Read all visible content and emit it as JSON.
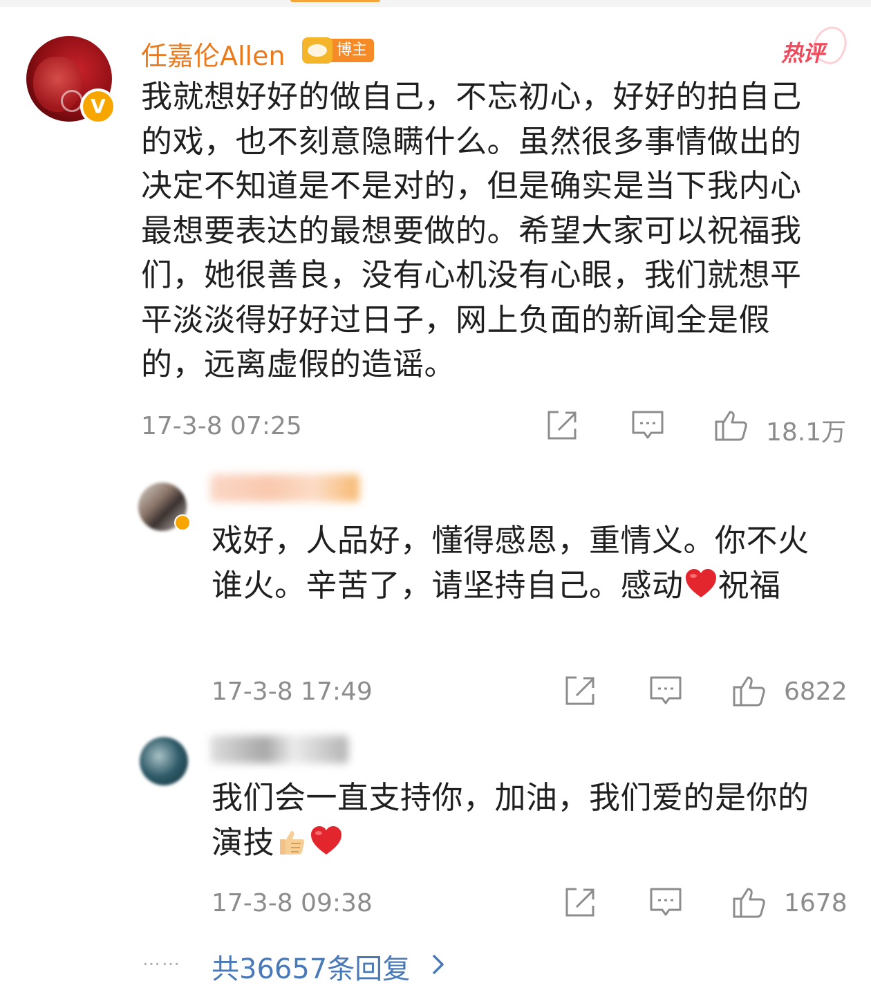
{
  "main_post": {
    "author": "任嘉伦Allen",
    "badge_label": "博主",
    "hot_tag": "热评",
    "verified_mark": "V",
    "text": "我就想好好的做自己，不忘初心，好好的拍自己的戏，也不刻意隐瞒什么。虽然很多事情做出的决定不知道是不是对的，但是确实是当下我内心最想要表达的最想要做的。希望大家可以祝福我们，她很善良，没有心机没有心眼，我们就想平平淡淡得好好过日子，网上负面的新闻全是假的，远离虚假的造谣。",
    "time": "17-3-8 07:25",
    "likes": "18.1万"
  },
  "replies": [
    {
      "text_before": "戏好，人品好，懂得感恩，重情义。你不火谁火。辛苦了，请坚持自己。感动",
      "text_after": "祝福",
      "emoji_end": "",
      "time": "17-3-8 17:49",
      "likes": "6822"
    },
    {
      "text_before": "我们会一直支持你，加油，我们爱的是你的演技",
      "text_after": "",
      "time": "17-3-8 09:38",
      "likes": "1678"
    }
  ],
  "footer": {
    "dots": "……",
    "more_replies": "共36657条回复"
  },
  "icons": {
    "share": "share-icon",
    "comment": "comment-icon",
    "like": "thumbs-up-icon",
    "heart": "heart-emoji-icon",
    "thumb_emoji": "thumbs-up-emoji-icon",
    "chevron": "chevron-right-icon"
  },
  "colors": {
    "author_name": "#ea7a1e",
    "hot_tag": "#f0495b",
    "link": "#4a79b8",
    "meta_gray": "#8c8c8c",
    "verified": "#f7a600"
  }
}
